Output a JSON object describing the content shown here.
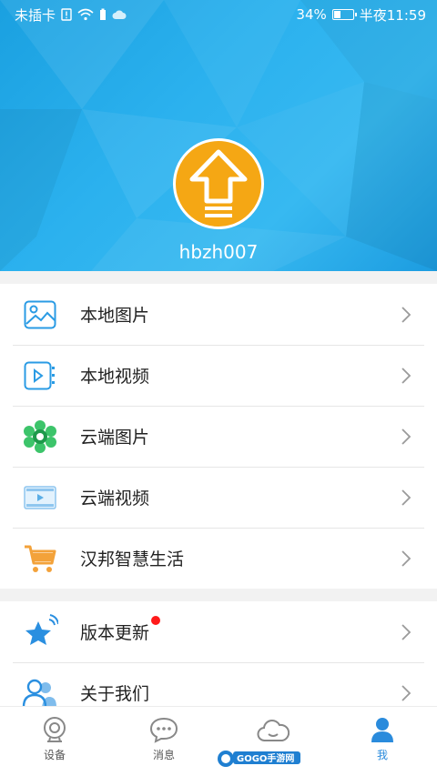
{
  "statusbar": {
    "carrier": "未插卡",
    "battery": "34%",
    "time": "半夜11:59"
  },
  "profile": {
    "username": "hbzh007"
  },
  "menu_group_1": [
    {
      "label": "本地图片",
      "icon": "local-image-icon"
    },
    {
      "label": "本地视频",
      "icon": "local-video-icon"
    },
    {
      "label": "云端图片",
      "icon": "cloud-image-icon"
    },
    {
      "label": "云端视频",
      "icon": "cloud-video-icon"
    },
    {
      "label": "汉邦智慧生活",
      "icon": "shopping-cart-icon"
    }
  ],
  "menu_group_2": [
    {
      "label": "版本更新",
      "icon": "star-icon",
      "badge": true
    },
    {
      "label": "关于我们",
      "icon": "people-icon"
    }
  ],
  "bottom_nav": [
    {
      "label": "设备",
      "icon": "camera-icon",
      "active": false
    },
    {
      "label": "消息",
      "icon": "chat-icon",
      "active": false
    },
    {
      "label": "",
      "icon": "cloud-icon",
      "active": false
    },
    {
      "label": "我",
      "icon": "person-icon",
      "active": true
    }
  ],
  "watermark": "GOGO手游网",
  "colors": {
    "header_blue": "#2bb1ee",
    "avatar_orange": "#f5a714",
    "active_tab": "#2a8bdc",
    "badge_red": "#ff1a1a"
  }
}
